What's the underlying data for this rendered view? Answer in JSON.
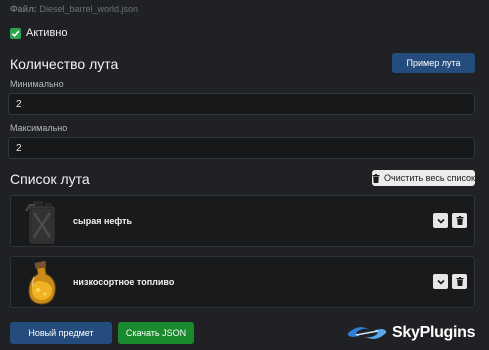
{
  "header": {
    "file_prefix": "Файл:",
    "file_name": "Diesel_barrel_world.json"
  },
  "active": {
    "label": "Активно",
    "checked": true
  },
  "loot_amount": {
    "title": "Количество лута",
    "example_button": "Пример лута",
    "min_label": "Минимально",
    "min_value": "2",
    "max_label": "Максимально",
    "max_value": "2"
  },
  "loot_list": {
    "title": "Список лута",
    "clear_button": "Очистить весь список",
    "items": [
      {
        "name": "сырая нефть",
        "icon": "jerrycan-icon"
      },
      {
        "name": "низкосортное топливо",
        "icon": "fuel-flask-icon"
      }
    ]
  },
  "footer": {
    "new_item_button": "Новый предмет",
    "download_button": "Скачать JSON"
  },
  "watermark": {
    "text": "SkyPlugins",
    "icon": "skyplugins-logo"
  },
  "colors": {
    "background": "#1f2124",
    "blue_button": "#244d7e",
    "green_button": "#1a8a2e",
    "checkbox": "#2ea44f"
  }
}
